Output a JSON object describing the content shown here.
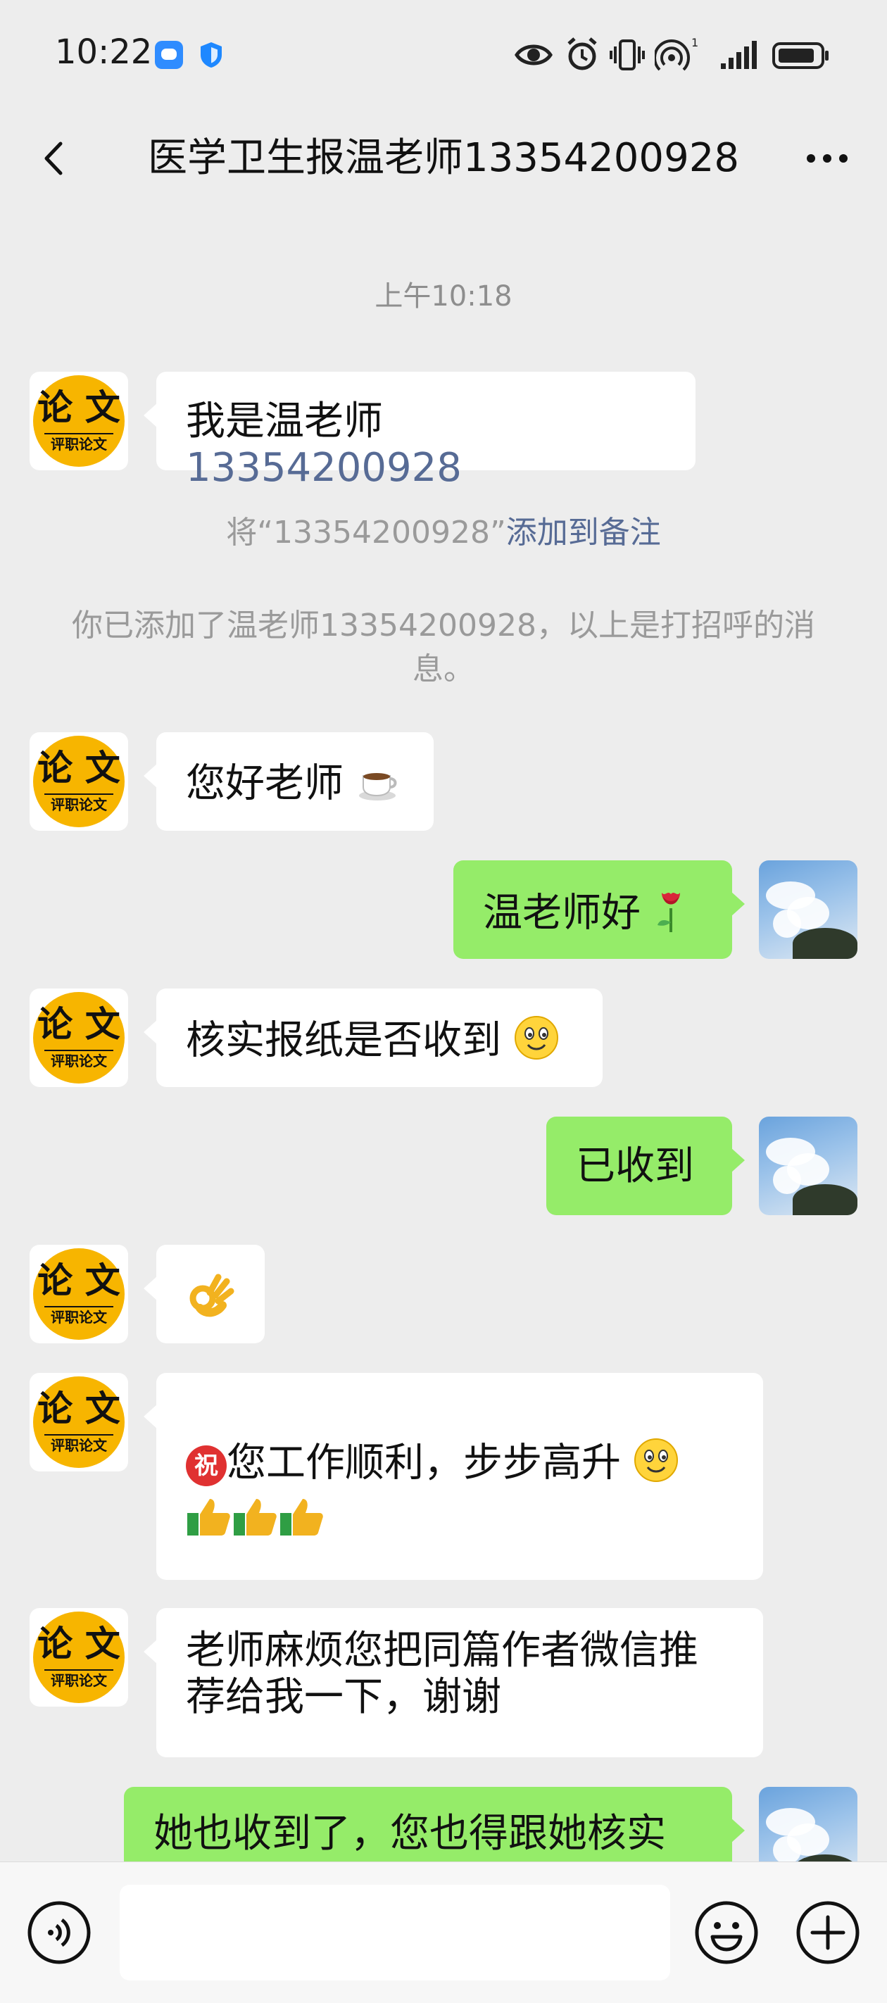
{
  "status_bar": {
    "time": "10:22",
    "battery_icon": "battery-icon",
    "signal_label": "1"
  },
  "header": {
    "title": "医学卫生报温老师13354200928",
    "back_icon": "back-chevron-icon",
    "more_icon": "more-dots-icon"
  },
  "chat": {
    "timestamp": "上午10:18",
    "contact_avatar_text_big": "论 文",
    "contact_avatar_text_small": "评职论文",
    "messages": [
      {
        "side": "left",
        "text": "我是温老师 ",
        "number": "13354200928"
      },
      {
        "side": "left",
        "text": "您好老师"
      },
      {
        "side": "right",
        "text": "温老师好"
      },
      {
        "side": "left",
        "text": "核实报纸是否收到"
      },
      {
        "side": "right",
        "text": "已收到"
      },
      {
        "side": "left",
        "text": ""
      },
      {
        "side": "left",
        "text": "您工作顺利，步步高升",
        "prefix_icon": "祝"
      },
      {
        "side": "left",
        "text": "老师麻烦您把同篇作者微信推荐给我一下，谢谢"
      },
      {
        "side": "right",
        "text": "她也收到了，您也得跟她核实"
      }
    ],
    "system_note_1": {
      "prefix": "将“13354200928”",
      "link": "添加到备注"
    },
    "system_note_2": "你已添加了温老师13354200928，以上是打招呼的消息。"
  },
  "input_bar": {
    "voice_icon": "voice-icon",
    "emoji_icon": "emoji-icon",
    "plus_icon": "plus-icon"
  },
  "colors": {
    "background": "#ededed",
    "bubble_self": "#95ec69",
    "bubble_other": "#ffffff",
    "link": "#576b95",
    "avatar_logo": "#f7b500"
  }
}
